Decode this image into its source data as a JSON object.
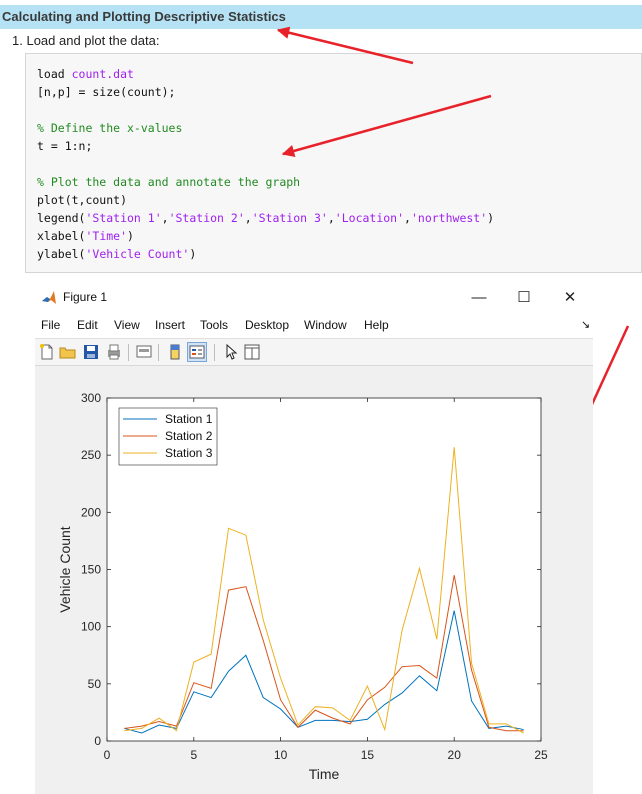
{
  "section_title": "Calculating and Plotting Descriptive Statistics",
  "step": {
    "number": "1.",
    "text": "Load and plot the data:"
  },
  "code": {
    "l1_kw": "load ",
    "l1_str": "count.dat",
    "l2": "[n,p] = size(count);",
    "l3": "% Define the x-values",
    "l4": "t = 1:n;",
    "l5": "% Plot the data and annotate the graph",
    "l6": "plot(t,count)",
    "l7_a": "legend(",
    "l7_s1": "'Station 1'",
    "l7_c1": ",",
    "l7_s2": "'Station 2'",
    "l7_c2": ",",
    "l7_s3": "'Station 3'",
    "l7_c3": ",",
    "l7_s4": "'Location'",
    "l7_c4": ",",
    "l7_s5": "'northwest'",
    "l7_e": ")",
    "l8_a": "xlabel(",
    "l8_s": "'Time'",
    "l8_e": ")",
    "l9_a": "ylabel(",
    "l9_s": "'Vehicle Count'",
    "l9_e": ")"
  },
  "figure": {
    "title": "Figure 1",
    "window_buttons": {
      "minimize": "—",
      "maximize": "☐",
      "close": "✕"
    },
    "menu": [
      "File",
      "Edit",
      "View",
      "Insert",
      "Tools",
      "Desktop",
      "Window",
      "Help"
    ],
    "dock_glyph": "↘"
  },
  "chart_data": {
    "type": "line",
    "x": [
      1,
      2,
      3,
      4,
      5,
      6,
      7,
      8,
      9,
      10,
      11,
      12,
      13,
      14,
      15,
      16,
      17,
      18,
      19,
      20,
      21,
      22,
      23,
      24
    ],
    "series": [
      {
        "name": "Station 1",
        "color": "#0072bd",
        "values": [
          11,
          7,
          14,
          11,
          43,
          38,
          61,
          75,
          38,
          28,
          12,
          18,
          18,
          17,
          19,
          32,
          42,
          57,
          44,
          114,
          35,
          11,
          13,
          10
        ]
      },
      {
        "name": "Station 2",
        "color": "#d95319",
        "values": [
          11,
          13,
          17,
          13,
          51,
          46,
          132,
          135,
          88,
          36,
          12,
          27,
          20,
          15,
          36,
          47,
          65,
          66,
          55,
          145,
          62,
          12,
          9,
          9
        ]
      },
      {
        "name": "Station 3",
        "color": "#edb120",
        "values": [
          9,
          11,
          20,
          9,
          69,
          76,
          186,
          180,
          106,
          55,
          14,
          30,
          29,
          18,
          48,
          10,
          97,
          151,
          89,
          257,
          68,
          15,
          15,
          7
        ]
      }
    ],
    "xlabel": "Time",
    "ylabel": "Vehicle Count",
    "xlim": [
      0,
      25
    ],
    "ylim": [
      0,
      300
    ],
    "xticks": [
      0,
      5,
      10,
      15,
      20,
      25
    ],
    "yticks": [
      0,
      50,
      100,
      150,
      200,
      250,
      300
    ],
    "grid": false,
    "legend_position": "top-left"
  }
}
